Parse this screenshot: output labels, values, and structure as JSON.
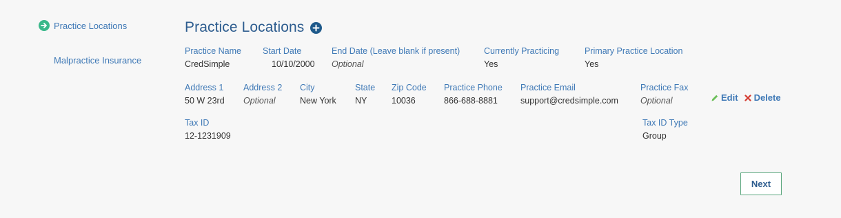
{
  "sidebar": {
    "items": [
      {
        "label": "Practice Locations",
        "icon": "arrow-circle-right-icon",
        "state": "completed"
      },
      {
        "label": "Malpractice Insurance"
      }
    ]
  },
  "main": {
    "title": "Practice Locations",
    "add_icon": "plus-circle-icon",
    "location": {
      "row1": [
        {
          "label": "Practice Name",
          "value": "CredSimple",
          "optional": false
        },
        {
          "label": "Start Date",
          "value": "10/10/2000",
          "optional": false
        },
        {
          "label": "End Date (Leave blank if present)",
          "value": "Optional",
          "optional": true
        },
        {
          "label": "Currently Practicing",
          "value": "Yes",
          "optional": false
        },
        {
          "label": "Primary Practice Location",
          "value": "Yes",
          "optional": false
        }
      ],
      "row2": [
        {
          "label": "Address 1",
          "value": "50 W 23rd",
          "optional": false
        },
        {
          "label": "Address 2",
          "value": "Optional",
          "optional": true
        },
        {
          "label": "City",
          "value": "New York",
          "optional": false
        },
        {
          "label": "State",
          "value": "NY",
          "optional": false
        },
        {
          "label": "Zip Code",
          "value": "10036",
          "optional": false
        },
        {
          "label": "Practice Phone",
          "value": "866-688-8881",
          "optional": false
        },
        {
          "label": "Practice Email",
          "value": "support@credsimple.com",
          "optional": false
        },
        {
          "label": "Practice Fax",
          "value": "Optional",
          "optional": true
        }
      ],
      "row3": [
        {
          "label": "Tax ID",
          "value": "12-1231909",
          "optional": false
        },
        {
          "label": "Tax ID Type",
          "value": "Group",
          "optional": false
        }
      ]
    },
    "actions": {
      "edit_label": "Edit",
      "delete_label": "Delete"
    },
    "next_label": "Next"
  },
  "colors": {
    "link": "#3f79b6",
    "title": "#2e5d8f",
    "success": "#3ab88a",
    "danger": "#d43a2f",
    "next_border": "#5aa67d"
  }
}
